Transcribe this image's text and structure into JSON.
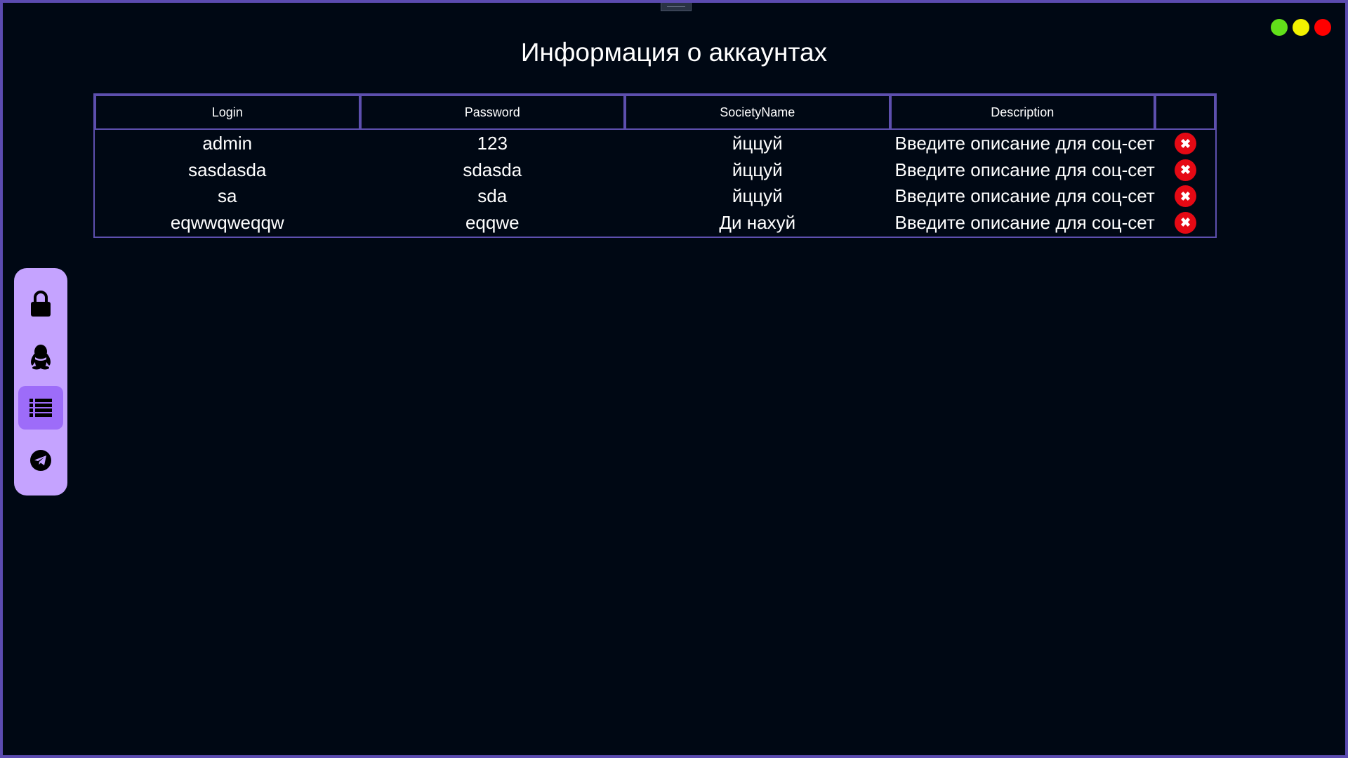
{
  "page_title": "Информация о аккаунтах",
  "window_controls": [
    {
      "name": "maximize",
      "color": "#62e01a"
    },
    {
      "name": "minimize",
      "color": "#f2f200"
    },
    {
      "name": "close",
      "color": "#ff0000"
    }
  ],
  "table": {
    "columns": [
      "Login",
      "Password",
      "SocietyName",
      "Description",
      ""
    ],
    "rows": [
      {
        "login": "admin",
        "password": "123",
        "society": "йццуй",
        "description": "Введите описание для соц-сети"
      },
      {
        "login": "sasdasda",
        "password": "sdasda",
        "society": "йццуй",
        "description": "Введите описание для соц-сети"
      },
      {
        "login": "sa",
        "password": "sda",
        "society": "йццуй",
        "description": "Введите описание для соц-сети"
      },
      {
        "login": "eqwwqweqqw",
        "password": "eqqwe",
        "society": "Ди нахуй",
        "description": "Введите описание для соц-сети"
      }
    ],
    "delete_icon": "close-circle-icon",
    "delete_color": "#e50914"
  },
  "sidebar": {
    "items": [
      {
        "icon": "lock-icon",
        "active": false
      },
      {
        "icon": "qq-penguin-icon",
        "active": false
      },
      {
        "icon": "list-icon",
        "active": true
      },
      {
        "icon": "telegram-icon",
        "active": false
      }
    ],
    "background": "#c5a3ff",
    "active_background": "#9d6cf9"
  },
  "colors": {
    "background": "#000814",
    "border": "#5d4fae",
    "text": "#ffffff"
  }
}
